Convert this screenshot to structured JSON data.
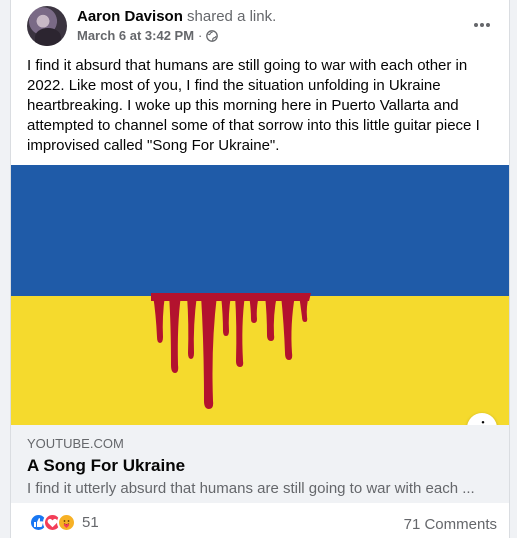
{
  "post": {
    "author": "Aaron Davison",
    "action": "shared a link.",
    "timestamp": "March 6 at 3:42 PM",
    "separator": "·",
    "privacy_icon": "globe-icon",
    "more_icon": "more-horizontal-icon",
    "text": "I find it absurd that humans are still going to war with each other in 2022.  Like most of you, I find the situation unfolding in Ukraine heartbreaking.  I woke up this morning here in Puerto Vallarta and attempted to channel some of that sorrow into this little guitar piece I improvised called \"Song For Ukraine\"."
  },
  "media": {
    "info_label": "i",
    "colors": {
      "blue": "#1f5ba8",
      "yellow": "#f5da2d",
      "blood": "#b3122e"
    }
  },
  "link": {
    "domain": "YOUTUBE.COM",
    "title": "A Song For Ukraine",
    "description": "I find it utterly absurd that humans are still going to war with each ..."
  },
  "footer": {
    "reactions": [
      "like",
      "love",
      "care"
    ],
    "reaction_count": "51",
    "comments": "71 Comments"
  }
}
